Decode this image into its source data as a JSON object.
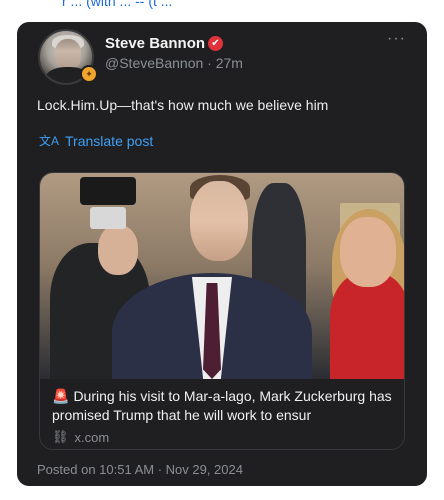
{
  "top_strip_text": "r ... (with ... -- (t ...",
  "post": {
    "author_name": "Steve Bannon",
    "verified_mark": "✔",
    "handle_time": "@SteveBannon · 27m",
    "more_label": "···",
    "text": "Lock.Him.Up—that's how much we believe him",
    "translate_label": "Translate post",
    "translate_icon": "文A",
    "avatar_badge": "✦",
    "link_card": {
      "siren": "🚨",
      "title": "During his visit to Mar-a-lago, Mark Zuckerburg has promised Trump that he will work to ensur",
      "domain_icon": "⛓",
      "domain": "x.com"
    },
    "posted_on": "Posted on 10:51 AM · Nov 29, 2024"
  },
  "colors": {
    "card_bg": "#1f1f21",
    "link_blue": "#3ea0f5",
    "verified_red": "#e0323b",
    "muted_text": "#8b8f94"
  },
  "icons": {
    "avatar": "avatar-icon",
    "verified": "verified-icon",
    "more": "more-icon",
    "translate": "translate-icon",
    "link": "link-icon",
    "siren": "siren-icon"
  }
}
